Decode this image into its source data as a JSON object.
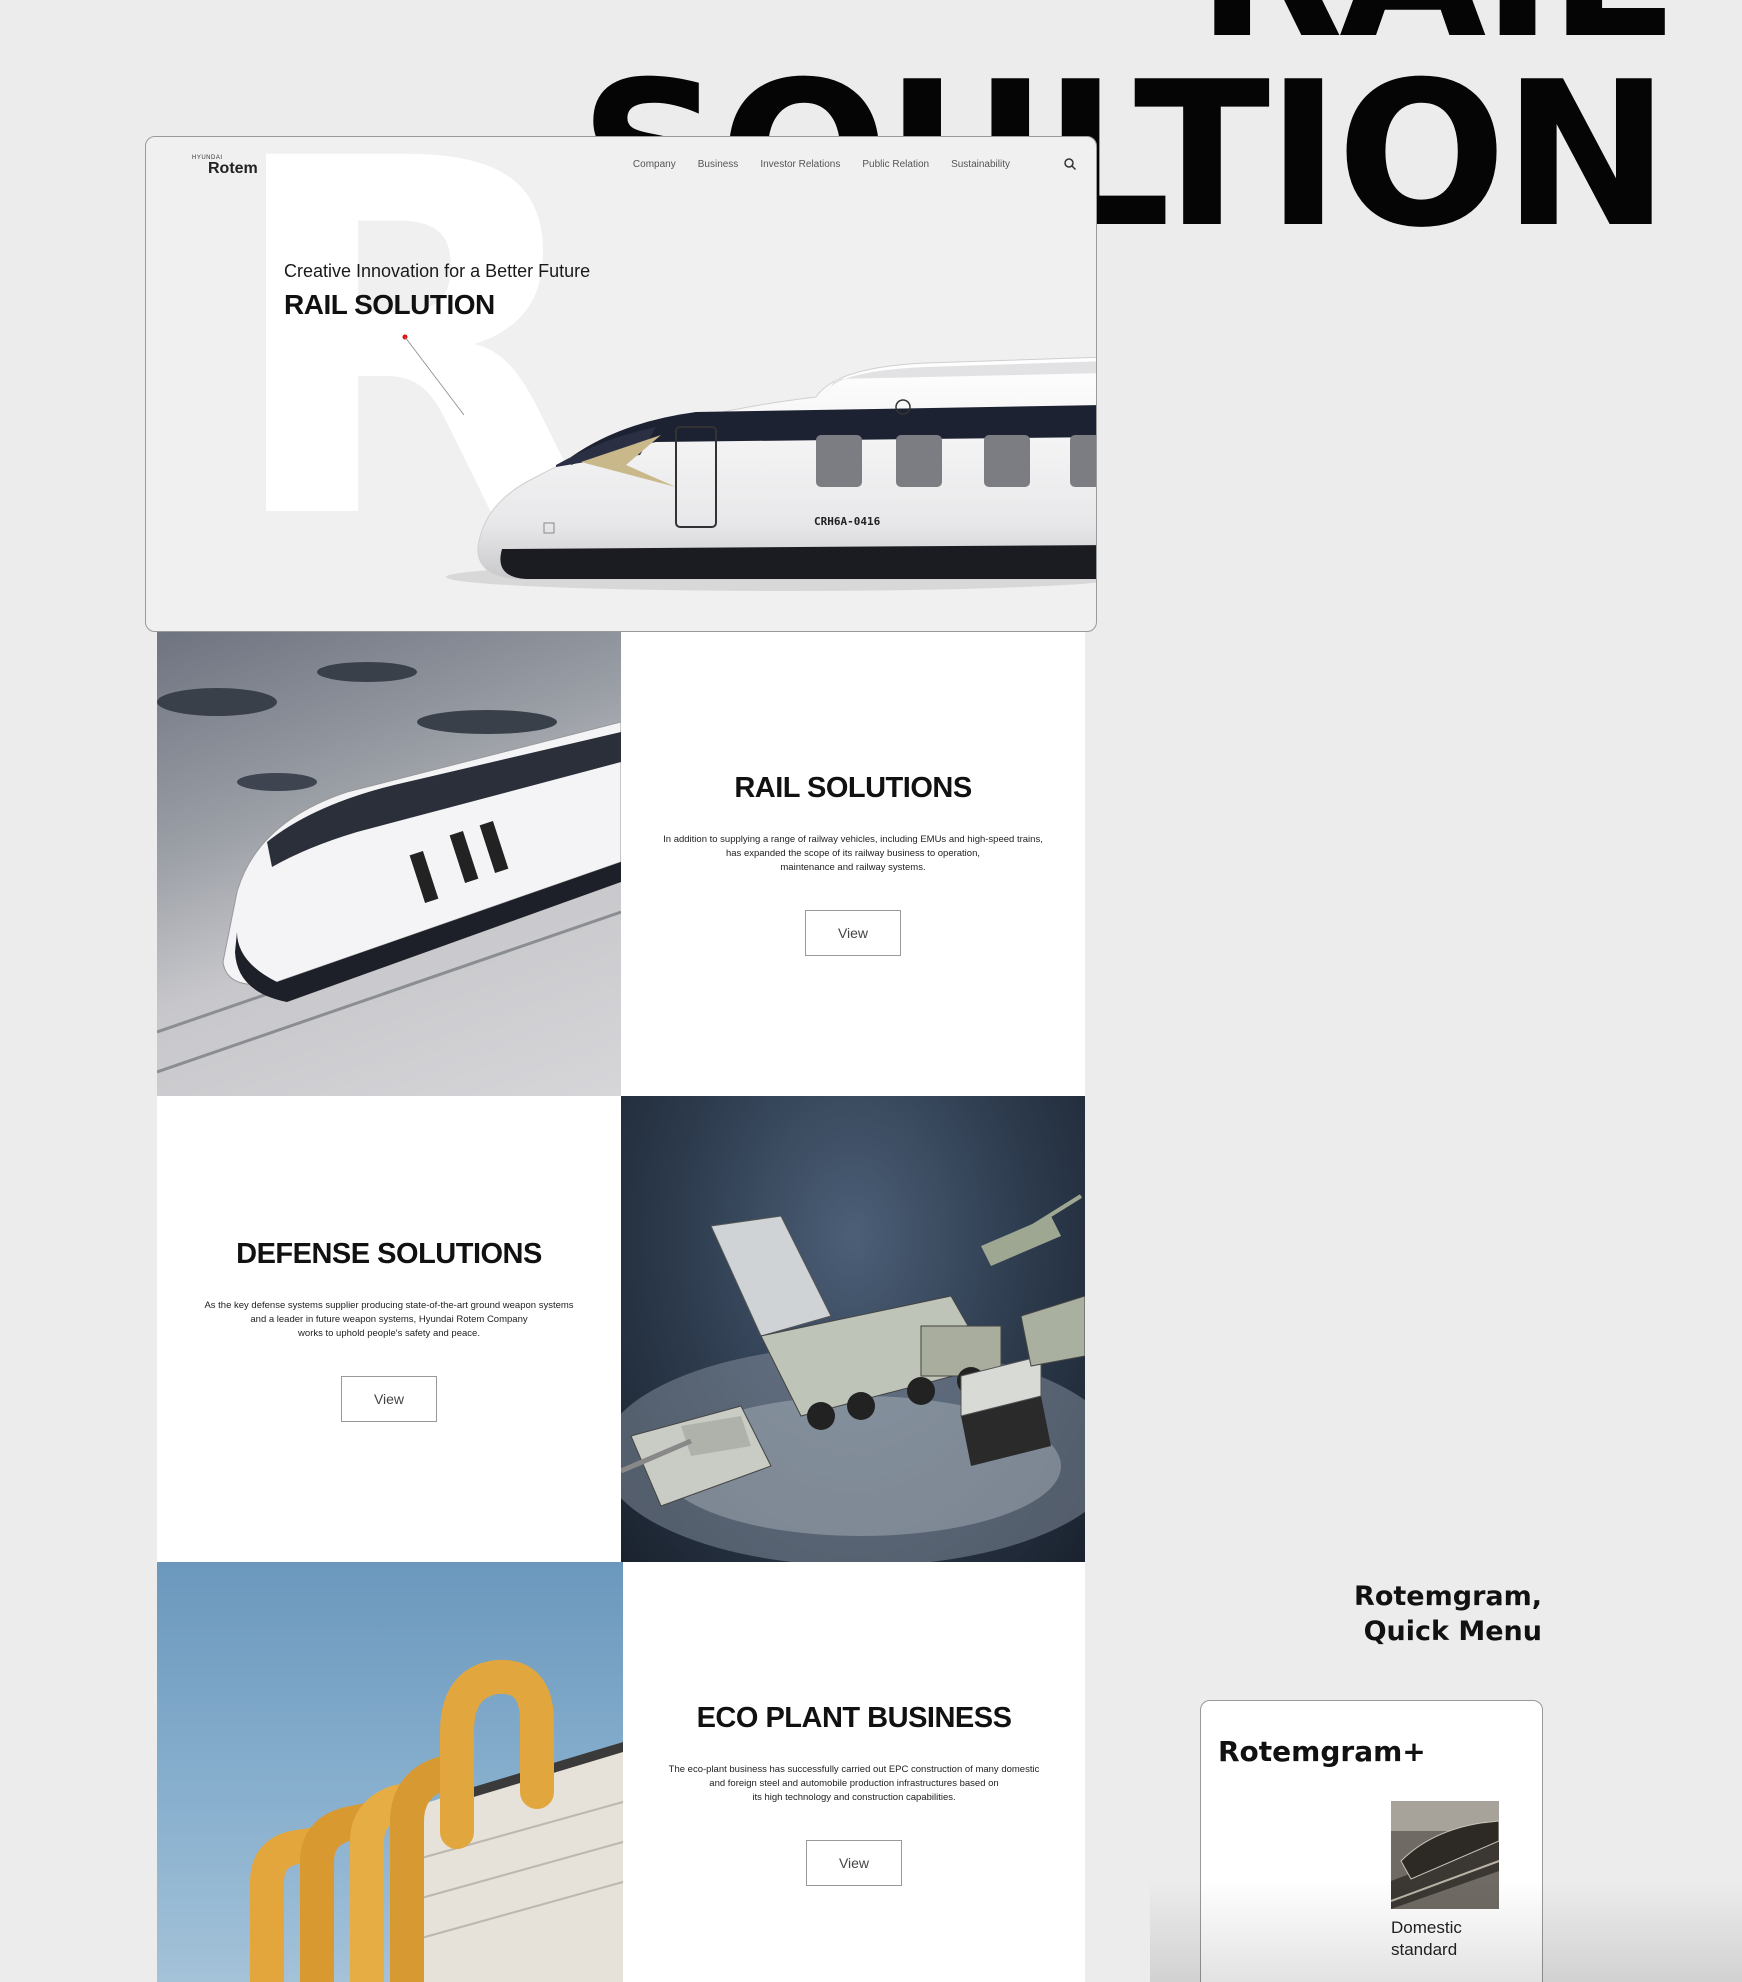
{
  "headline": {
    "line1": "RAIL",
    "line2": "SOULTION"
  },
  "hero": {
    "logo_small": "HYUNDAI",
    "logo_main": "Rotem",
    "nav": [
      "Company",
      "Business",
      "Investor Relations",
      "Public Relation",
      "Sustainability"
    ],
    "big_letter": "R",
    "tagline": "Creative Innovation for a Better Future",
    "title": "RAIL SOLUTION",
    "train_code": "CRH6A-0416"
  },
  "sections": {
    "rail": {
      "title": "RAIL SOLUTIONS",
      "desc": "In addition to supplying a range of railway vehicles, including EMUs and high-speed trains,\nhas expanded the scope of its railway business to operation,\nmaintenance and railway systems.",
      "button": "View"
    },
    "defense": {
      "title": "DEFENSE SOLUTIONS",
      "desc": "As the key defense systems supplier producing state-of-the-art ground weapon systems\nand a leader in future weapon systems, Hyundai Rotem Company\nworks to uphold people's safety and peace.",
      "button": "View"
    },
    "eco": {
      "title": "ECO PLANT BUSINESS",
      "desc": "The eco-plant business has successfully carried out EPC construction of many domestic\nand foreign steel and automobile production infrastructures based on\nits high technology and construction capabilities.",
      "button": "View"
    }
  },
  "quick_menu": {
    "heading_line1": "Rotemgram,",
    "heading_line2": "Quick Menu",
    "card_title": "Rotemgram+",
    "caption": "Domestic\nstandard"
  }
}
